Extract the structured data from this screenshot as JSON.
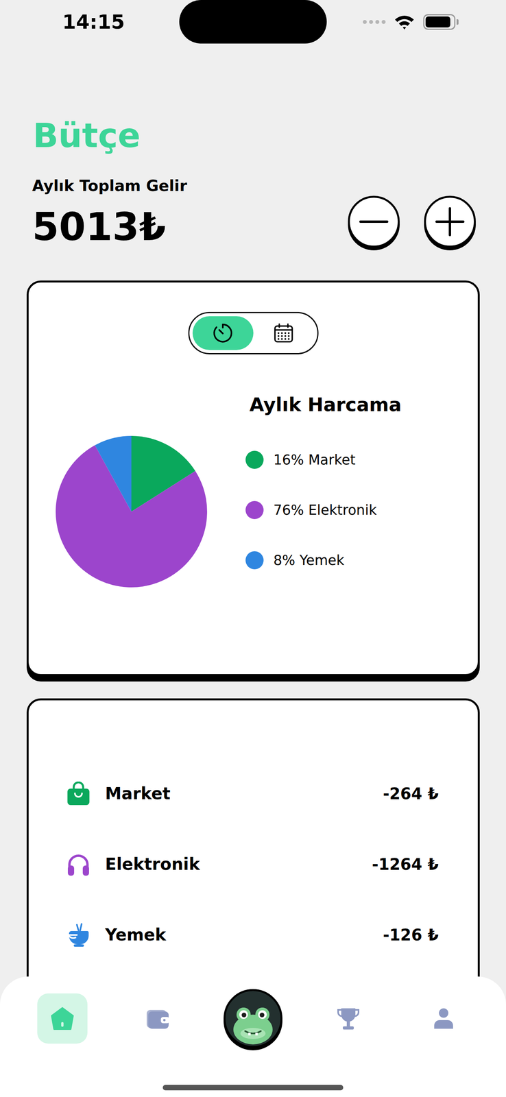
{
  "status_bar": {
    "time": "14:15",
    "cellular_bars": 0,
    "wifi": true,
    "battery_level": 0.9
  },
  "title": "Bütçe",
  "income": {
    "label": "Aylık Toplam Gelir",
    "amount": "5013₺"
  },
  "actions": [
    {
      "kind": "minus"
    },
    {
      "kind": "plus"
    }
  ],
  "view_toggle": [
    {
      "kind": "timer",
      "selected": true
    },
    {
      "kind": "calendar",
      "selected": false
    }
  ],
  "chart": {
    "title": "Aylık Harcama",
    "slices": [
      {
        "label": "16% Market",
        "value": 16,
        "color": "#0aa85c"
      },
      {
        "label": "76% Elektronik",
        "value": 76,
        "color": "#9c45cc"
      },
      {
        "label": "8% Yemek",
        "value": 8,
        "color": "#2f86e0"
      }
    ]
  },
  "transactions": [
    {
      "name": "Market",
      "amount": "-264 ₺",
      "kind": "market",
      "color": "#0aa85c"
    },
    {
      "name": "Elektronik",
      "amount": "-1264 ₺",
      "kind": "electronics",
      "color": "#9c45cc"
    },
    {
      "name": "Yemek",
      "amount": "-126 ₺",
      "kind": "food",
      "color": "#2f86e0"
    }
  ],
  "nav": [
    {
      "kind": "home",
      "selected": true
    },
    {
      "kind": "wallet",
      "selected": false
    },
    {
      "kind": "mascot",
      "selected": false
    },
    {
      "kind": "trophy",
      "selected": false
    },
    {
      "kind": "profile",
      "selected": false
    }
  ]
}
